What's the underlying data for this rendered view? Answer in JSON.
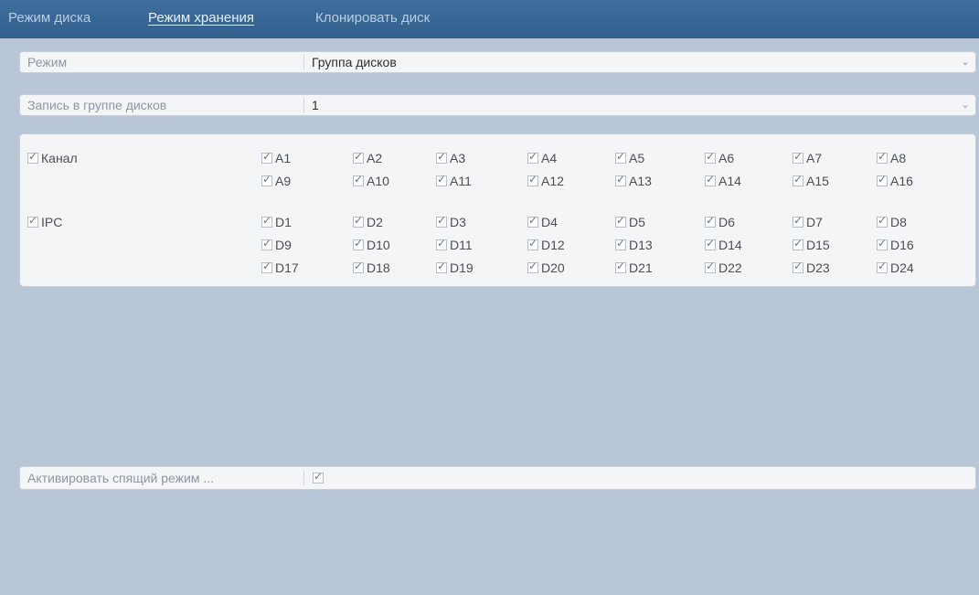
{
  "tabs": [
    {
      "label": "Режим диска",
      "active": false
    },
    {
      "label": "Режим хранения",
      "active": true
    },
    {
      "label": "Клонировать диск",
      "active": false
    }
  ],
  "mode": {
    "label": "Режим",
    "value": "Группа дисков"
  },
  "group": {
    "label": "Запись в группе дисков",
    "value": "1"
  },
  "channels": {
    "label": "Канал",
    "checked": true,
    "items": [
      "A1",
      "A2",
      "A3",
      "A4",
      "A5",
      "A6",
      "A7",
      "A8",
      "A9",
      "A10",
      "A11",
      "A12",
      "A13",
      "A14",
      "A15",
      "A16"
    ]
  },
  "ipc": {
    "label": "IPC",
    "checked": true,
    "items": [
      "D1",
      "D2",
      "D3",
      "D4",
      "D5",
      "D6",
      "D7",
      "D8",
      "D9",
      "D10",
      "D11",
      "D12",
      "D13",
      "D14",
      "D15",
      "D16",
      "D17",
      "D18",
      "D19",
      "D20",
      "D21",
      "D22",
      "D23",
      "D24"
    ]
  },
  "sleep": {
    "label": "Активировать спящий режим ...",
    "checked": true
  },
  "colors": {
    "tab_bar": "#3a6a99",
    "background": "#b9c6d8",
    "row": "#f4f5f7"
  },
  "icons": {
    "dropdown": "chevron-down-icon",
    "checkbox": "check-icon"
  }
}
